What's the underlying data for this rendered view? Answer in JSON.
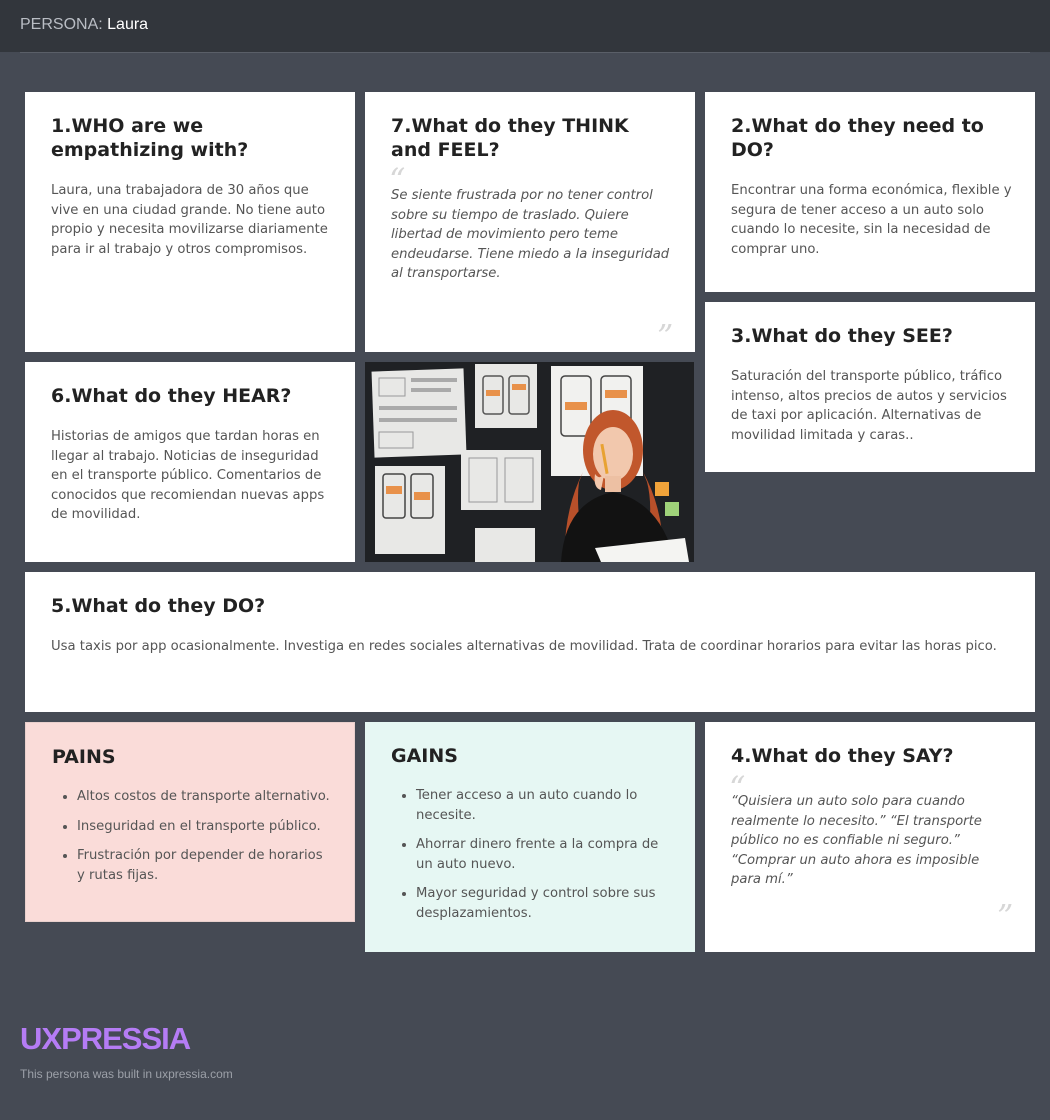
{
  "header": {
    "label": "PERSONA:",
    "persona_name": "Laura"
  },
  "cards": {
    "who": {
      "title": "1.WHO are we empathizing with?",
      "body": "Laura, una trabajadora de 30 años que vive en una ciudad grande. No tiene auto propio y necesita movilizarse diariamente para ir al trabajo y otros compromisos."
    },
    "think_feel": {
      "title": "7.What do they THINK and FEEL?",
      "body": "Se siente frustrada por no tener control sobre su tiempo de traslado. Quiere libertad de movimiento pero teme endeudarse. Tiene miedo a la inseguridad al transportarse."
    },
    "need_do": {
      "title": "2.What do they need to DO?",
      "body": "Encontrar una forma económica, flexible y segura de tener acceso a un auto solo cuando lo necesite, sin la necesidad de comprar uno."
    },
    "see": {
      "title": "3.What do they SEE?",
      "body": "Saturación del transporte público, tráfico intenso, altos precios de autos y servicios de taxi por aplicación. Alternativas de movilidad limitada y caras.."
    },
    "hear": {
      "title": "6.What do they HEAR?",
      "body": "Historias de amigos que tardan horas en llegar al trabajo. Noticias de inseguridad en el transporte público. Comentarios de conocidos que recomiendan nuevas apps de movilidad."
    },
    "do": {
      "title": "5.What do they DO?",
      "body": "Usa taxis por app ocasionalmente. Investiga en redes sociales alternativas de movilidad. Trata de coordinar horarios para evitar las horas pico."
    },
    "pains": {
      "title": "PAINS",
      "items": [
        "Altos costos de transporte alternativo.",
        "Inseguridad en el transporte público.",
        "Frustración por depender de horarios y rutas fijas."
      ]
    },
    "gains": {
      "title": "GAINS",
      "items": [
        "Tener acceso a un auto cuando lo necesite.",
        "Ahorrar dinero frente a la compra de un auto nuevo.",
        "Mayor seguridad y control sobre sus desplazamientos."
      ]
    },
    "say": {
      "title": "4.What do they SAY?",
      "body": "“Quisiera un auto solo para cuando realmente lo necesito.” “El transporte público no es confiable ni seguro.” “Comprar un auto ahora es imposible para mí.”"
    }
  },
  "footer": {
    "logo": "UXPRESSIA",
    "note": "This persona was built in uxpressia.com"
  },
  "colors": {
    "background": "#454a54",
    "topbar": "#32363c",
    "pains_bg": "#fadcd9",
    "gains_bg": "#e6f7f3",
    "logo": "#b57cf5"
  },
  "icons": {
    "open_quote": "open-quote-icon",
    "close_quote": "close-quote-icon"
  }
}
